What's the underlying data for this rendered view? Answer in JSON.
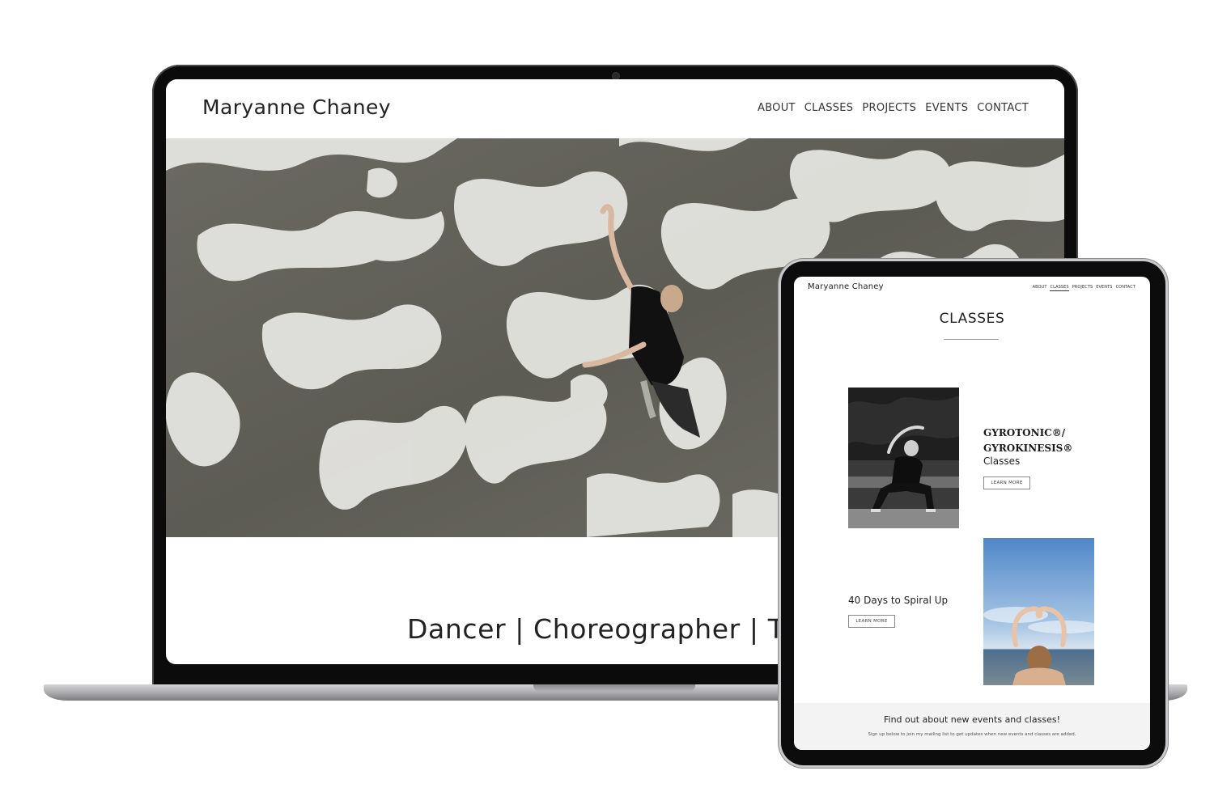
{
  "laptop": {
    "site_title": "Maryanne Chaney",
    "nav": [
      "ABOUT",
      "CLASSES",
      "PROJECTS",
      "EVENTS",
      "CONTACT"
    ],
    "tagline": "Dancer | Choreographer | Teacher"
  },
  "tablet": {
    "site_title": "Maryanne Chaney",
    "nav": [
      "ABOUT",
      "CLASSES",
      "PROJECTS",
      "EVENTS",
      "CONTACT"
    ],
    "active_nav": "CLASSES",
    "page_title": "CLASSES",
    "classes": [
      {
        "name_line1": "GYROTONIC®/",
        "name_line2": "GYROKINESIS®",
        "subtitle": "Classes",
        "button": "LEARN MORE"
      },
      {
        "name": "40 Days to Spiral Up",
        "button": "LEARN MORE"
      }
    ],
    "footer": {
      "title": "Find out about new events and classes!",
      "subtitle": "Sign up below to join my mailing list to get updates when new events and classes are added."
    }
  },
  "colors": {
    "device_frame": "#0b0b0b",
    "laptop_base": "#a9a9ac",
    "hero_water": "#5f5f57",
    "foam": "#e6e6e3",
    "footer_bg": "#f3f3f3"
  }
}
